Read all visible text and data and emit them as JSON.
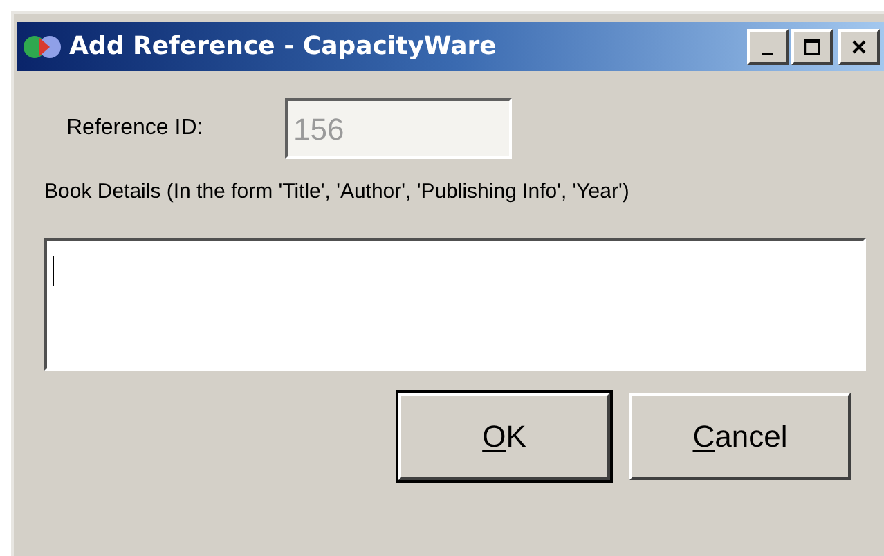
{
  "window": {
    "title": "Add Reference - CapacityWare"
  },
  "reference_id": {
    "label": "Reference ID:",
    "value": "156",
    "disabled": true
  },
  "book_details": {
    "label": "Book Details (In the form 'Title', 'Author', 'Publishing Info', 'Year')",
    "focused": true
  },
  "buttons": [
    {
      "label": "OK",
      "mnemonic_underlined": true,
      "default": true
    },
    {
      "label": "Cancel",
      "mnemonic_underlined": true,
      "default": false
    }
  ]
}
